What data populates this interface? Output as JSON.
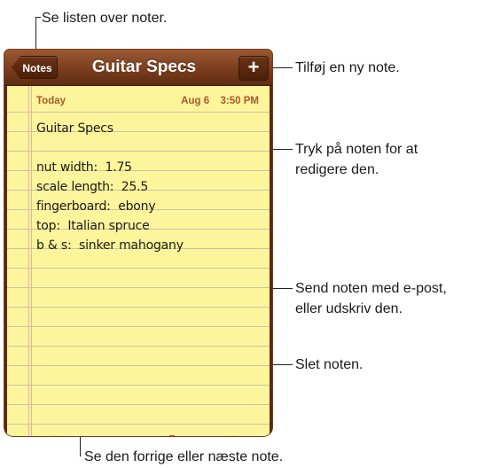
{
  "callouts": {
    "list_notes": "Se listen over noter.",
    "new_note": "Tilføj en ny note.",
    "edit_line1": "Tryk på noten for at",
    "edit_line2": "redigere den.",
    "send_line1": "Send noten med e-post,",
    "send_line2": "eller udskriv den.",
    "delete": "Slet noten.",
    "prev_next": "Se den forrige eller næste note."
  },
  "navbar": {
    "back_label": "Notes",
    "title": "Guitar Specs",
    "add_label": "+"
  },
  "note": {
    "day": "Today",
    "date": "Aug 6",
    "time": "3:50 PM",
    "lines": [
      "Guitar Specs",
      "nut width:  1.75",
      "scale length:  25.5",
      "fingerboard:  ebony",
      "top:  Italian spruce",
      "b & s:  sinker mahogany"
    ]
  },
  "toolbar": {
    "icons": [
      "previous-note-icon",
      "send-icon",
      "trash-icon",
      "next-note-icon"
    ]
  },
  "colors": {
    "navbar": "#7a3d1d",
    "paper": "#fdf59c",
    "icon": "#c0591f"
  }
}
